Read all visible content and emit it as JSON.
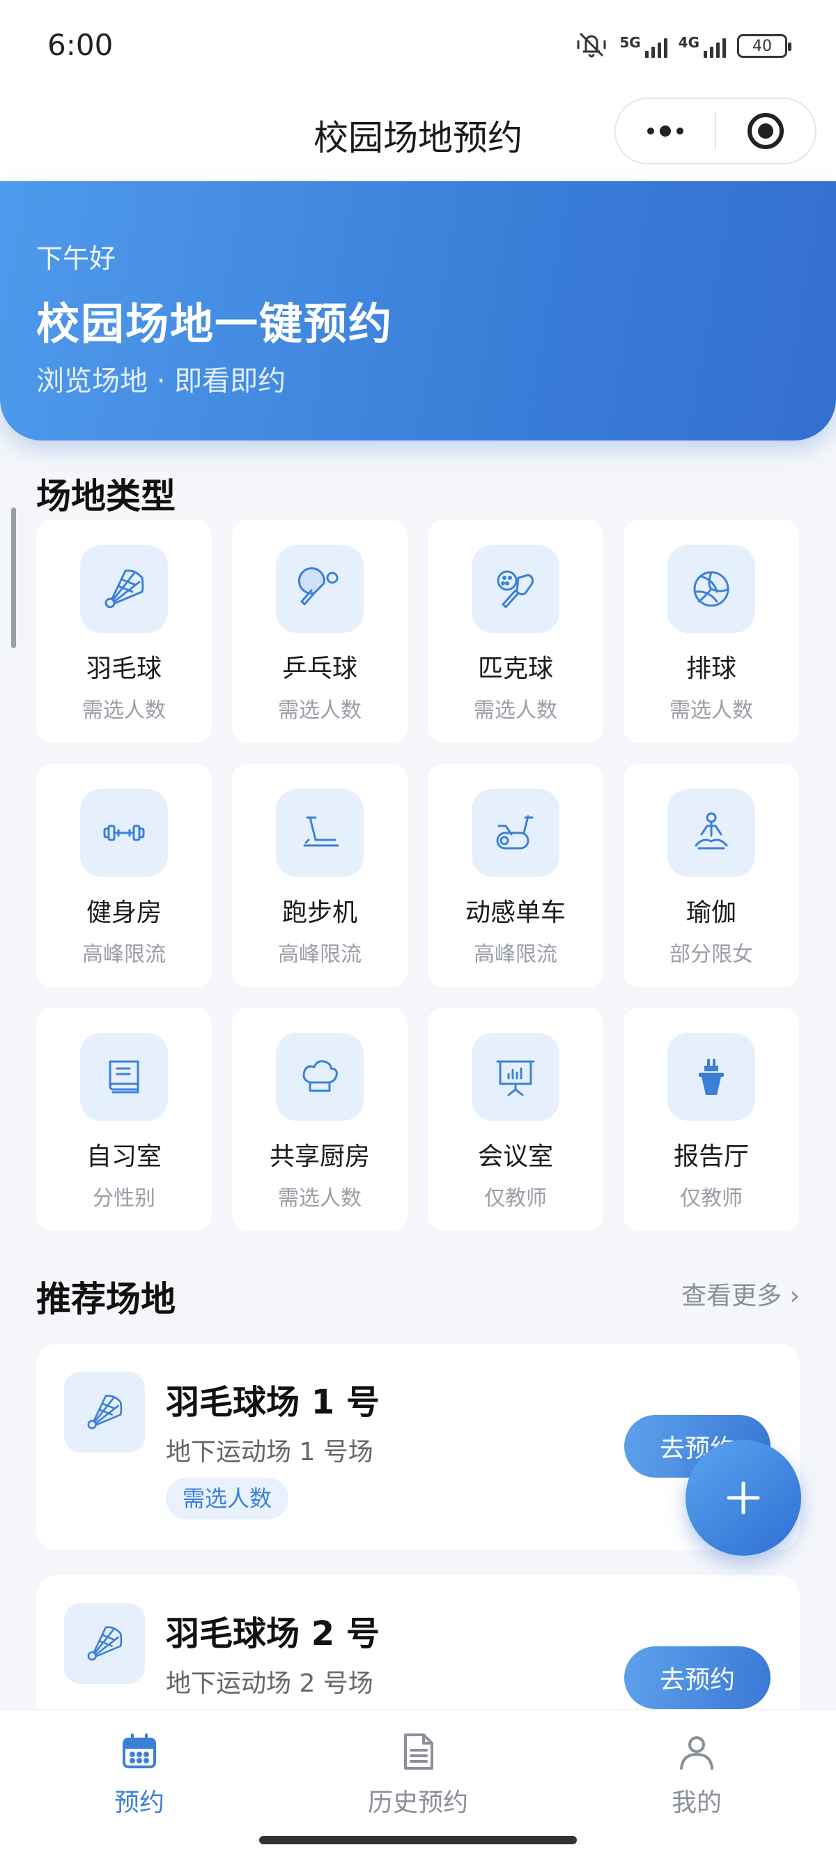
{
  "status_bar": {
    "time": "6:00",
    "net_5g": "5G",
    "net_4g": "4G",
    "battery": "40",
    "icons": [
      "mute-vibrate-icon",
      "signal-icon",
      "battery-icon"
    ]
  },
  "nav": {
    "title": "校园场地预约",
    "more_icon": "more-dots-icon",
    "close_icon": "target-icon"
  },
  "hero": {
    "greeting": "下午好",
    "title": "校园场地一键预约",
    "subtitle": "浏览场地 · 即看即约"
  },
  "categories_section": {
    "title": "场地类型",
    "items": [
      {
        "name": "羽毛球",
        "note": "需选人数",
        "icon": "badminton-icon"
      },
      {
        "name": "乒乓球",
        "note": "需选人数",
        "icon": "ping-pong-icon"
      },
      {
        "name": "匹克球",
        "note": "需选人数",
        "icon": "pickleball-icon"
      },
      {
        "name": "排球",
        "note": "需选人数",
        "icon": "volleyball-icon"
      },
      {
        "name": "健身房",
        "note": "高峰限流",
        "icon": "dumbbell-icon"
      },
      {
        "name": "跑步机",
        "note": "高峰限流",
        "icon": "treadmill-icon"
      },
      {
        "name": "动感单车",
        "note": "高峰限流",
        "icon": "spin-bike-icon"
      },
      {
        "name": "瑜伽",
        "note": "部分限女",
        "icon": "yoga-icon"
      },
      {
        "name": "自习室",
        "note": "分性别",
        "icon": "book-icon"
      },
      {
        "name": "共享厨房",
        "note": "需选人数",
        "icon": "chef-hat-icon"
      },
      {
        "name": "会议室",
        "note": "仅教师",
        "icon": "presentation-icon"
      },
      {
        "name": "报告厅",
        "note": "仅教师",
        "icon": "podium-icon"
      }
    ]
  },
  "recommend_section": {
    "title": "推荐场地",
    "more": "查看更多 ›",
    "venues": [
      {
        "name": "羽毛球场 1 号",
        "location": "地下运动场 1 号场",
        "tag": "需选人数",
        "button": "去预约",
        "icon": "badminton-icon"
      },
      {
        "name": "羽毛球场 2 号",
        "location": "地下运动场 2 号场",
        "tag": "",
        "button": "去预约",
        "icon": "badminton-icon"
      }
    ]
  },
  "fab": {
    "icon": "plus-icon"
  },
  "tab_bar": {
    "tabs": [
      {
        "label": "预约",
        "icon": "calendar-icon",
        "active": true
      },
      {
        "label": "历史预约",
        "icon": "document-icon",
        "active": false
      },
      {
        "label": "我的",
        "icon": "user-icon",
        "active": false
      }
    ]
  },
  "colors": {
    "accent": "#3b80d8",
    "hero_start": "#4f9aec",
    "hero_end": "#346fd0",
    "icon_bg": "#e6f0fc",
    "page_bg": "#f4f6fa"
  }
}
